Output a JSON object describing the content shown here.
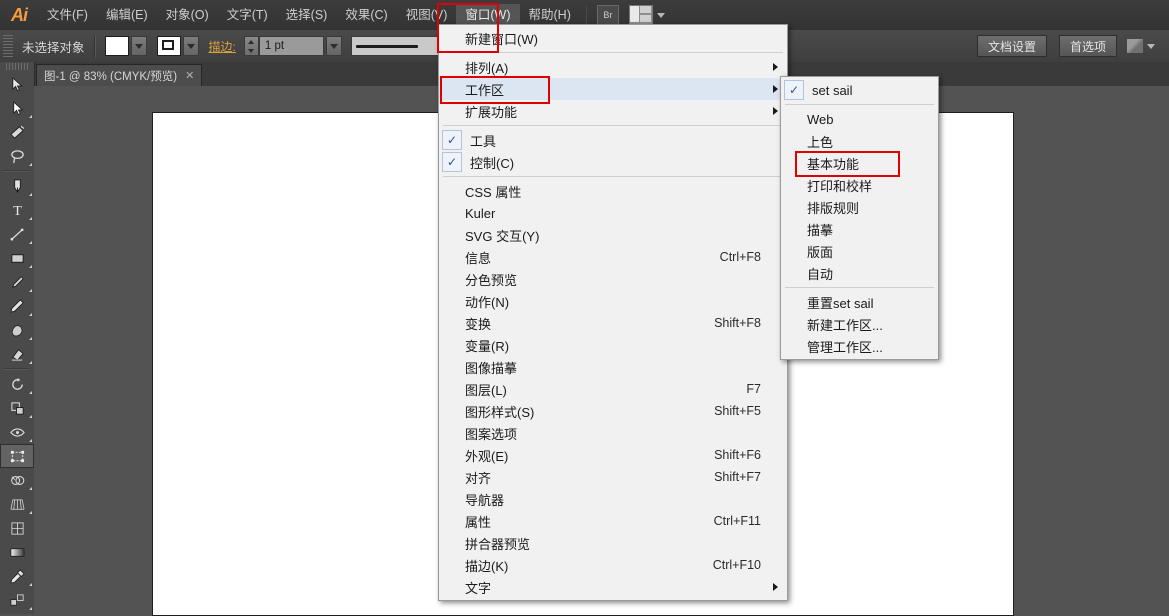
{
  "app": {
    "logo": "Ai",
    "menus": [
      {
        "label": "文件(F)"
      },
      {
        "label": "编辑(E)"
      },
      {
        "label": "对象(O)"
      },
      {
        "label": "文字(T)"
      },
      {
        "label": "选择(S)"
      },
      {
        "label": "效果(C)"
      },
      {
        "label": "视图(V)"
      },
      {
        "label": "窗口(W)"
      },
      {
        "label": "帮助(H)"
      }
    ],
    "bridge_label": "Br",
    "arrange_icon": "arrange-documents-icon"
  },
  "control_bar": {
    "selection_status": "未选择对象",
    "fill_swatch": "fill-white",
    "stroke_swatch": "stroke-white",
    "stroke_label": "描边:",
    "stroke_weight": "1 pt",
    "stroke_profile": "等比",
    "document_setup_label": "文档设置",
    "preferences_label": "首选项",
    "doc_icon": "document-icon"
  },
  "tabbar": {
    "doc_title": "图-1 @ 83% (CMYK/预览)",
    "close_glyph": "✕",
    "collapse_glyph": "»"
  },
  "tools": {
    "collapse_glyph": "»",
    "close_glyph": "✕",
    "items": [
      {
        "name": "selection-tool",
        "selected": false
      },
      {
        "name": "direct-selection-tool",
        "selected": false
      },
      {
        "name": "magic-wand-tool",
        "selected": false
      },
      {
        "name": "lasso-tool",
        "selected": false
      },
      {
        "name": "pen-tool",
        "selected": false
      },
      {
        "name": "type-tool",
        "selected": false
      },
      {
        "name": "line-segment-tool",
        "selected": false
      },
      {
        "name": "rectangle-tool",
        "selected": false
      },
      {
        "name": "paintbrush-tool",
        "selected": false
      },
      {
        "name": "pencil-tool",
        "selected": false
      },
      {
        "name": "blob-brush-tool",
        "selected": false
      },
      {
        "name": "eraser-tool",
        "selected": false
      },
      {
        "name": "rotate-tool",
        "selected": false
      },
      {
        "name": "scale-tool",
        "selected": false
      },
      {
        "name": "width-tool",
        "selected": false
      },
      {
        "name": "free-transform-tool",
        "selected": true
      },
      {
        "name": "shape-builder-tool",
        "selected": false
      },
      {
        "name": "perspective-grid-tool",
        "selected": false
      },
      {
        "name": "mesh-tool",
        "selected": false
      },
      {
        "name": "gradient-tool",
        "selected": false
      },
      {
        "name": "eyedropper-tool",
        "selected": false
      },
      {
        "name": "blend-tool",
        "selected": false
      }
    ]
  },
  "window_menu": {
    "items": [
      {
        "label": "新建窗口(W)",
        "checked": false,
        "submenu": false,
        "accel": "",
        "sep_after": true
      },
      {
        "label": "排列(A)",
        "checked": false,
        "submenu": true,
        "accel": "",
        "sep_after": false
      },
      {
        "label": "工作区",
        "checked": false,
        "submenu": true,
        "accel": "",
        "highlight": true,
        "sep_after": false
      },
      {
        "label": "扩展功能",
        "checked": false,
        "submenu": true,
        "accel": "",
        "sep_after": true
      },
      {
        "label": "工具",
        "checked": true,
        "submenu": false,
        "accel": "",
        "sep_after": false
      },
      {
        "label": "控制(C)",
        "checked": true,
        "submenu": false,
        "accel": "",
        "sep_after": true
      },
      {
        "label": "CSS 属性",
        "checked": false,
        "submenu": false,
        "accel": ""
      },
      {
        "label": "Kuler",
        "checked": false,
        "submenu": false,
        "accel": ""
      },
      {
        "label": "SVG 交互(Y)",
        "checked": false,
        "submenu": false,
        "accel": ""
      },
      {
        "label": "信息",
        "checked": false,
        "submenu": false,
        "accel": "Ctrl+F8"
      },
      {
        "label": "分色预览",
        "checked": false,
        "submenu": false,
        "accel": ""
      },
      {
        "label": "动作(N)",
        "checked": false,
        "submenu": false,
        "accel": ""
      },
      {
        "label": "变换",
        "checked": false,
        "submenu": false,
        "accel": "Shift+F8"
      },
      {
        "label": "变量(R)",
        "checked": false,
        "submenu": false,
        "accel": ""
      },
      {
        "label": "图像描摹",
        "checked": false,
        "submenu": false,
        "accel": ""
      },
      {
        "label": "图层(L)",
        "checked": false,
        "submenu": false,
        "accel": "F7"
      },
      {
        "label": "图形样式(S)",
        "checked": false,
        "submenu": false,
        "accel": "Shift+F5"
      },
      {
        "label": "图案选项",
        "checked": false,
        "submenu": false,
        "accel": ""
      },
      {
        "label": "外观(E)",
        "checked": false,
        "submenu": false,
        "accel": "Shift+F6"
      },
      {
        "label": "对齐",
        "checked": false,
        "submenu": false,
        "accel": "Shift+F7"
      },
      {
        "label": "导航器",
        "checked": false,
        "submenu": false,
        "accel": ""
      },
      {
        "label": "属性",
        "checked": false,
        "submenu": false,
        "accel": "Ctrl+F11"
      },
      {
        "label": "拼合器预览",
        "checked": false,
        "submenu": false,
        "accel": ""
      },
      {
        "label": "描边(K)",
        "checked": false,
        "submenu": false,
        "accel": "Ctrl+F10"
      },
      {
        "label": "文字",
        "checked": false,
        "submenu": true,
        "accel": ""
      }
    ]
  },
  "workspace_menu": {
    "items": [
      {
        "label": "set sail",
        "checked": true,
        "sep_after": true
      },
      {
        "label": "Web",
        "checked": false
      },
      {
        "label": "上色",
        "checked": false
      },
      {
        "label": "基本功能",
        "checked": false,
        "highlight": true
      },
      {
        "label": "打印和校样",
        "checked": false
      },
      {
        "label": "排版规则",
        "checked": false
      },
      {
        "label": "描摹",
        "checked": false
      },
      {
        "label": "版面",
        "checked": false
      },
      {
        "label": "自动",
        "checked": false,
        "sep_after": true
      },
      {
        "label": "重置set sail",
        "checked": false
      },
      {
        "label": "新建工作区...",
        "checked": false
      },
      {
        "label": "管理工作区...",
        "checked": false
      }
    ]
  },
  "annotations": {
    "highlight_color": "#e00000",
    "boxes": [
      "window-menu-title",
      "workspace-item",
      "essentials-item"
    ]
  }
}
